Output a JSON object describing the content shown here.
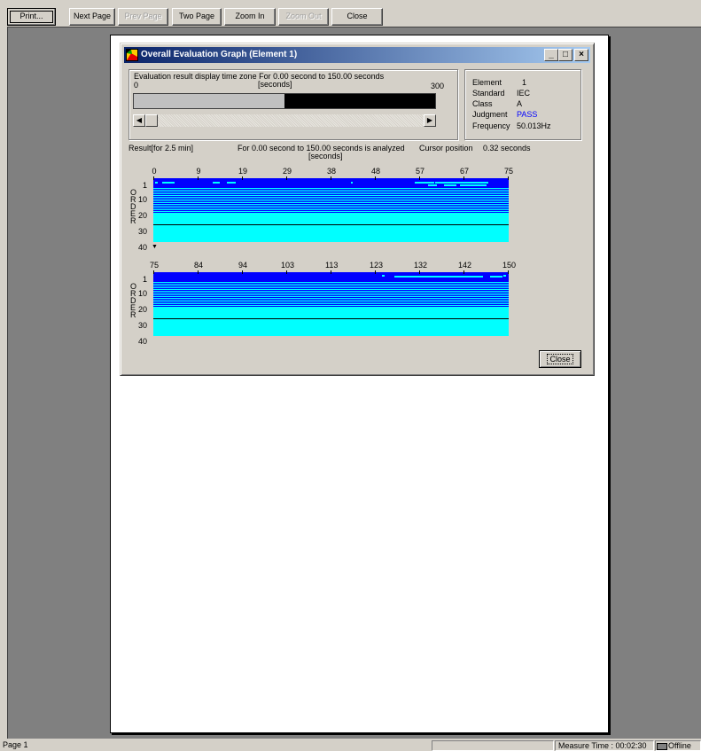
{
  "toolbar": {
    "print": "Print...",
    "next_page": "Next Page",
    "prev_page": "Prev Page",
    "two_page": "Two Page",
    "zoom_in": "Zoom In",
    "zoom_out": "Zoom Out",
    "close": "Close"
  },
  "dialog": {
    "title": "Overall Evaluation Graph (Element 1)",
    "time_zone": {
      "label": "Evaluation result display time zone  For   0.00 second to 150.00 seconds",
      "unit": "[seconds]",
      "scale_min": "0",
      "scale_max": "300",
      "selected_fraction": 0.5
    },
    "info": {
      "element_label": "Element",
      "element_value": "1",
      "standard_label": "Standard",
      "standard_value": "IEC",
      "class_label": "Class",
      "class_value": "A",
      "judgment_label": "Judgment",
      "judgment_value": "PASS",
      "frequency_label": "Frequency",
      "frequency_value": "50.013Hz"
    },
    "result": {
      "label": "Result[for 2.5 min]",
      "range_text": "For   0.00 second to 150.00 seconds is analyzed",
      "unit": "[seconds]",
      "cursor_label": "Cursor position",
      "cursor_value": "0.32 seconds"
    },
    "order_axis_letters": [
      "O",
      "R",
      "D",
      "E",
      "R"
    ],
    "y_ticks": [
      "1",
      "10",
      "20",
      "30",
      "40"
    ],
    "graph1_x_ticks": [
      "0",
      "9",
      "19",
      "29",
      "38",
      "48",
      "57",
      "67",
      "75"
    ],
    "graph2_x_ticks": [
      "75",
      "84",
      "94",
      "103",
      "113",
      "123",
      "132",
      "142",
      "150"
    ],
    "close_button": "Close"
  },
  "status": {
    "page": "Page 1",
    "measure_time": "Measure Time : 00:02:30",
    "connection": "Offline"
  },
  "colors": {
    "graph_fail_band": "#0000ff",
    "graph_pass": "#00ffff",
    "judgment_pass": "#0000ff"
  }
}
